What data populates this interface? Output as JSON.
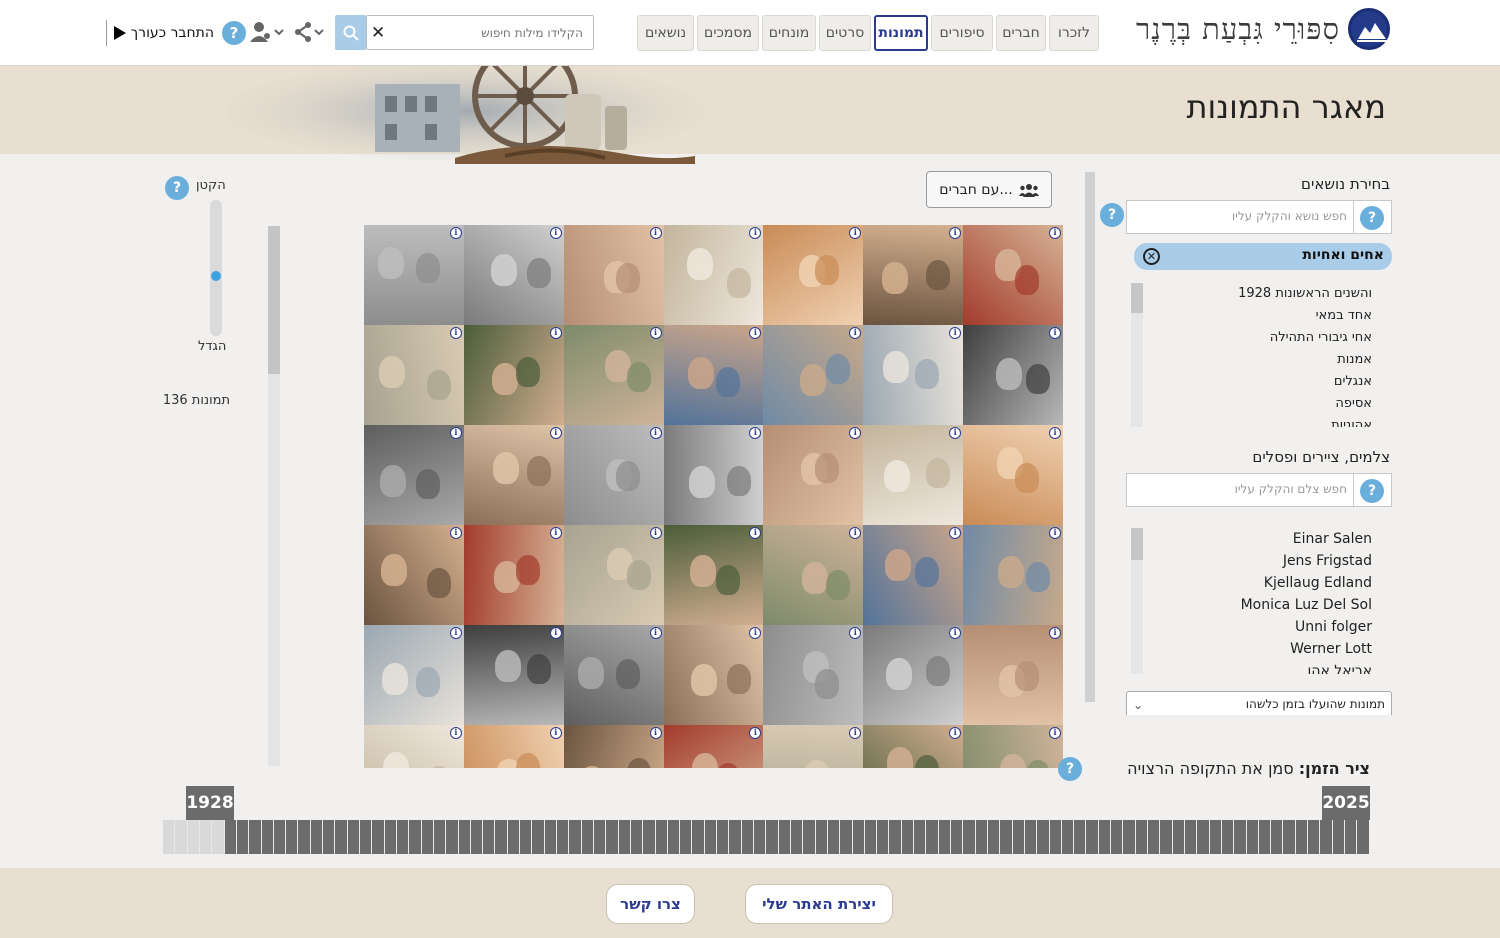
{
  "site": {
    "title": "סִפּוּרֵי גִּבְעַת בְּרֶנֶר"
  },
  "nav": {
    "tabs": [
      "לזכרו",
      "חברים",
      "סיפורים",
      "תמונות",
      "סרטים",
      "מונחים",
      "מסמכים",
      "נושאים"
    ],
    "active": "תמונות"
  },
  "search": {
    "placeholder": "הקלידו מילות חיפוש",
    "clear_icon": "close-icon",
    "search_icon": "search-icon"
  },
  "header": {
    "login_label": "התחבר כעורך",
    "help_label": "?"
  },
  "page": {
    "title": "מאגר התמונות"
  },
  "topics": {
    "title": "בחירת נושאים",
    "search_placeholder": "חפש נושא והקלק עליו",
    "selected": "אחים ואחיות",
    "items": [
      "1928 והשנים הראשונות",
      "אחד במאי",
      "אחי גיבורי התהילה",
      "אמנות",
      "אנגלים",
      "אסיפה",
      "אהוניות"
    ]
  },
  "photographers": {
    "title": "צלמים, ציירים ופסלים",
    "search_placeholder": "חפש צלם והקלק עליו",
    "items": [
      "Einar Salen",
      "Jens Frigstad",
      "Kjellaug Edland",
      "Monica Luz Del Sol",
      "Unni folger",
      "Werner Lott",
      "אריאל אהו"
    ]
  },
  "dropdown": {
    "selected": "תמונות שהועלו בזמן כלשהו"
  },
  "grid": {
    "friends_button": "עם חברים..."
  },
  "zoom": {
    "out_label": "הקטן",
    "in_label": "הגדל",
    "level": 0.55,
    "count_label": "136 תמונות"
  },
  "timeline": {
    "label_bold": "ציר הזמן:",
    "label_rest": " סמן את התקופה הרצויה",
    "start_year": "1928",
    "end_year": "2025"
  },
  "footer": {
    "create_site": "יצירת האתר שלי",
    "contact": "צרו קשר"
  },
  "colors": {
    "accent": "#2b3a8f",
    "help": "#6aaedc",
    "banner": "#e8dfd0",
    "timeline": "#6b6b6b"
  }
}
